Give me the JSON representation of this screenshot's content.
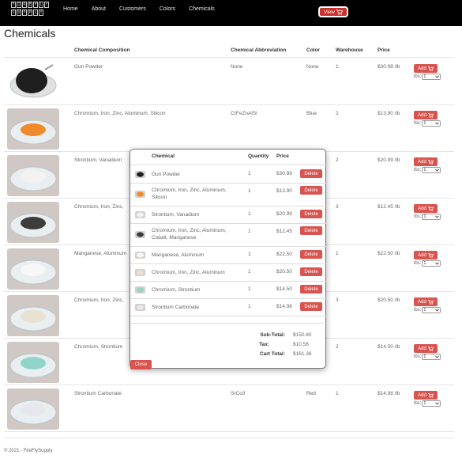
{
  "nav": {
    "logo_rows": [
      [
        "F",
        "I",
        "R",
        "E",
        "F",
        "L",
        "Y"
      ],
      [
        "S",
        "U",
        "P",
        "P",
        "L",
        "Y"
      ]
    ],
    "links": [
      "Home",
      "About",
      "Customers",
      "Colors",
      "Chemicals"
    ],
    "view_label": "View"
  },
  "page": {
    "title": "Chemicals"
  },
  "table": {
    "headers": {
      "composition": "Chemical Composition",
      "abbreviation": "Chemical Abbreviation",
      "color": "Color",
      "warehouse": "Warehouse",
      "price": "Price"
    },
    "add_label": "Add",
    "lbs_label": "lbs:",
    "lbs_value": "1",
    "rows": [
      {
        "composition": "Gun Powder",
        "abbreviation": "None",
        "color": "None",
        "warehouse": "1",
        "price": "$30.98 /lb",
        "swatch": "#1f1f1f"
      },
      {
        "composition": "Chromium, Iron, Zinc, Aluminum, Silicon",
        "abbreviation": "CrFeZnAlSi",
        "color": "Blue",
        "warehouse": "2",
        "price": "$13.90 /lb",
        "swatch": "#f08a2a"
      },
      {
        "composition": "Strontium, Vanadium",
        "abbreviation": "",
        "color": "",
        "warehouse": "2",
        "price": "$20.99 /lb",
        "swatch": "#f2f2f2"
      },
      {
        "composition": "Chromium, Iron, Zinc,",
        "abbreviation": "",
        "color": "",
        "warehouse": "3",
        "price": "$12.45 /lb",
        "swatch": "#3c3c3c"
      },
      {
        "composition": "Manganese, Aluminum",
        "abbreviation": "",
        "color": "",
        "warehouse": "1",
        "price": "$22.50 /lb",
        "swatch": "#f7f7f7"
      },
      {
        "composition": "Chromium, Iron, Zinc,",
        "abbreviation": "",
        "color": "",
        "warehouse": "3",
        "price": "$20.50 /lb",
        "swatch": "#e8e2d4"
      },
      {
        "composition": "Chromium, Strontium",
        "abbreviation": "",
        "color": "",
        "warehouse": "2",
        "price": "$14.50 /lb",
        "swatch": "#8fd6c8"
      },
      {
        "composition": "Strontium Carbonate",
        "abbreviation": "SrCo3",
        "color": "Red",
        "warehouse": "1",
        "price": "$14.98 /lb",
        "swatch": "#e6e8ee"
      }
    ]
  },
  "cart": {
    "headers": {
      "chemical": "Chemical",
      "quantity": "Quantity",
      "price": "Price"
    },
    "delete_label": "Delete",
    "items": [
      {
        "name": "Gun Powder",
        "qty": "1",
        "price": "$30.98",
        "swatch": "#1f1f1f"
      },
      {
        "name": "Chromium, Iron, Zinc, Aluminum, Silicon",
        "qty": "1",
        "price": "$13.90",
        "swatch": "#f08a2a"
      },
      {
        "name": "Strontium, Vanadium",
        "qty": "1",
        "price": "$20.99",
        "swatch": "#f2f2f2"
      },
      {
        "name": "Chromium, Iron, Zinc, Aluminum, Cobalt, Manganese",
        "qty": "1",
        "price": "$12.45",
        "swatch": "#3c3c3c"
      },
      {
        "name": "Manganese, Aluminum",
        "qty": "1",
        "price": "$22.50",
        "swatch": "#f7f7f7"
      },
      {
        "name": "Chromium, Iron, Zinc, Aluminum",
        "qty": "1",
        "price": "$20.50",
        "swatch": "#e8e2d4"
      },
      {
        "name": "Chromium, Strontium",
        "qty": "1",
        "price": "$14.50",
        "swatch": "#8fd6c8"
      },
      {
        "name": "Strontium Carbonate",
        "qty": "1",
        "price": "$14.98",
        "swatch": "#e6e8ee"
      }
    ],
    "subtotal_label": "Sub-Total:",
    "subtotal": "$150.80",
    "tax_label": "Tax:",
    "tax": "$10.56",
    "total_label": "Cart Total:",
    "total": "$161.36",
    "close_label": "Close"
  },
  "footer": {
    "text": "© 2021 - FireFlySupply"
  },
  "colors": {
    "nav_bg": "#000000",
    "danger": "#d9534f"
  }
}
